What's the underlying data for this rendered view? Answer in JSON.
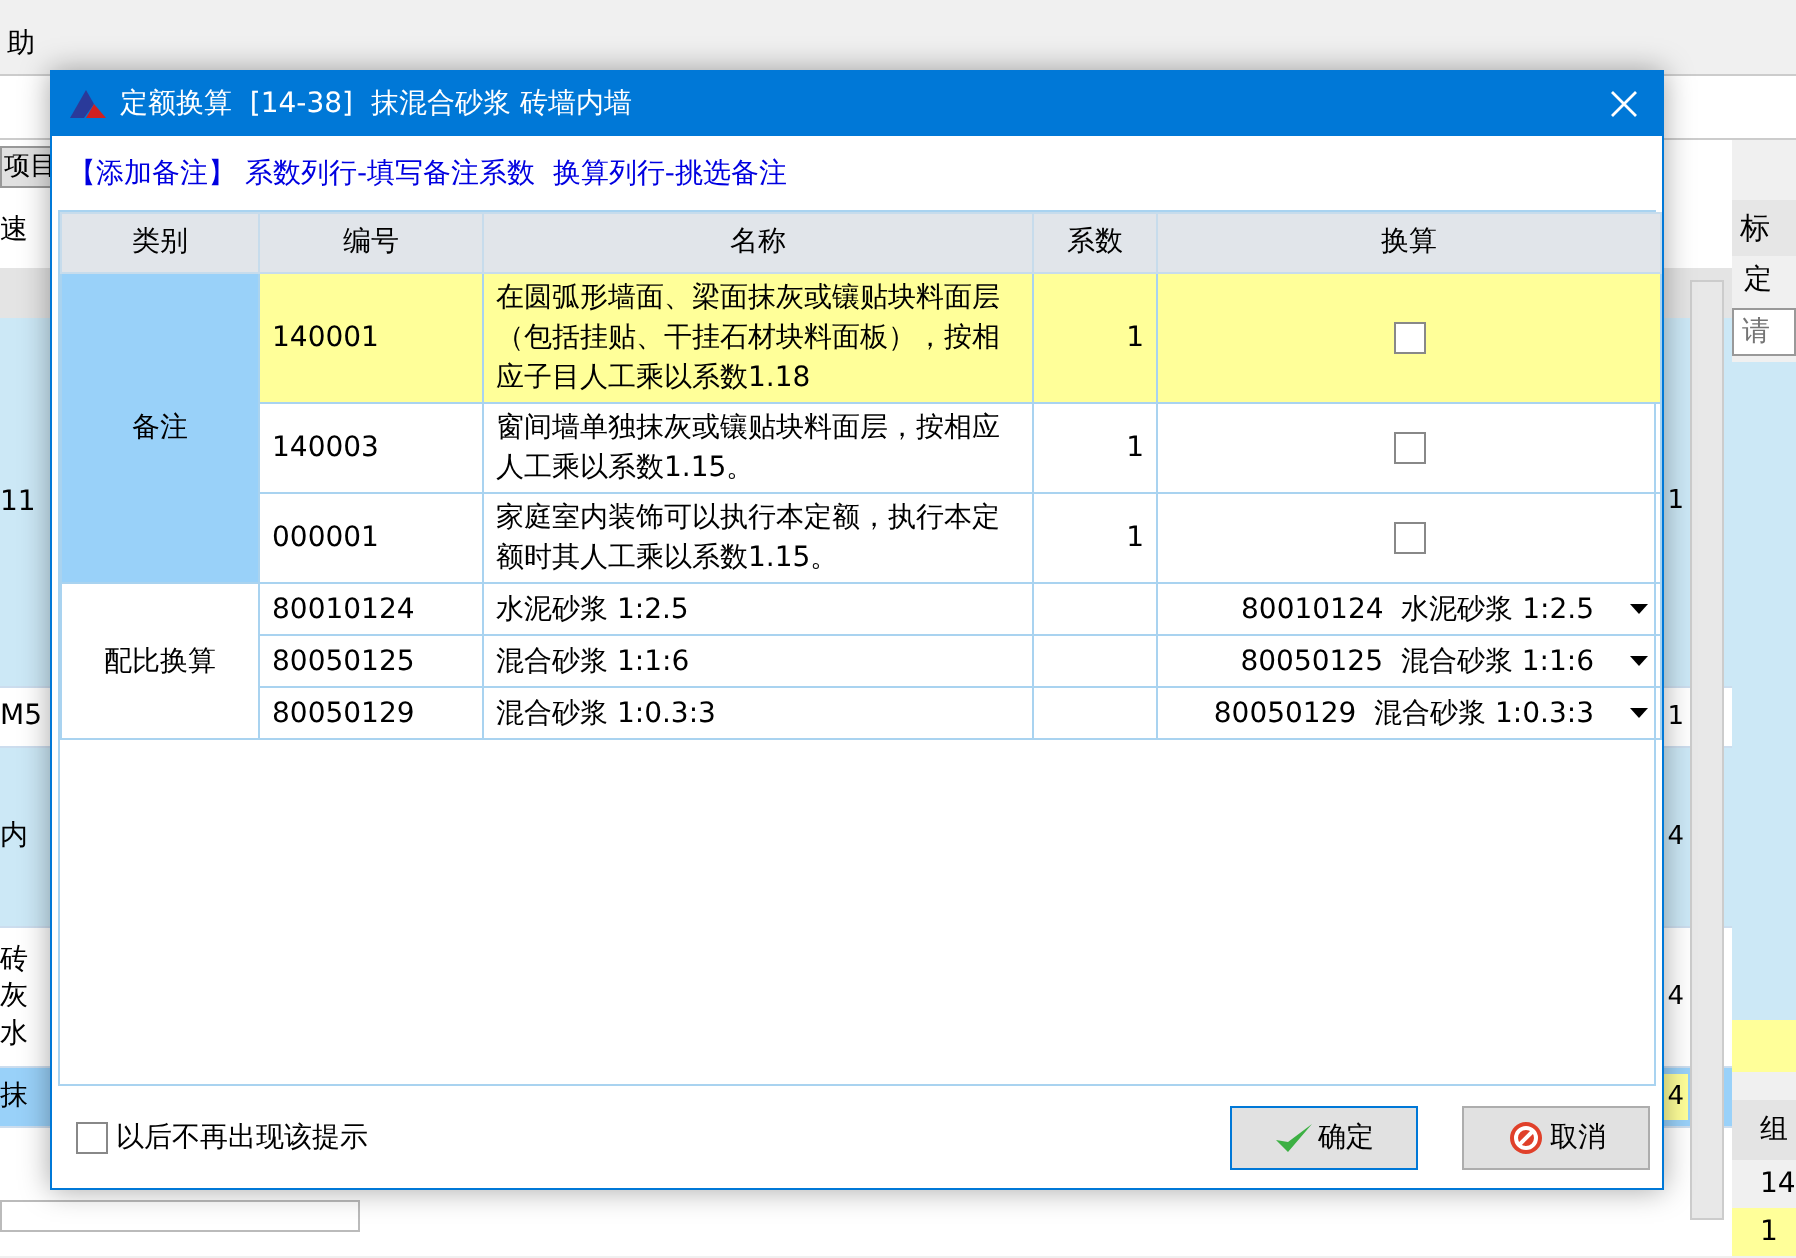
{
  "app": {
    "menu": [
      "助"
    ],
    "left_tab": "项目",
    "left_label": "速",
    "rows": [
      {
        "text": "11",
        "value": "1",
        "kind": "tall",
        "selected": false
      },
      {
        "text": "M5",
        "value": "1",
        "kind": "short",
        "selected": false
      },
      {
        "text": "内",
        "value": "4",
        "kind": "mid",
        "selected": false
      },
      {
        "lines": [
          "砖",
          "灰",
          "水"
        ],
        "value": "4",
        "kind": "white",
        "selected": false
      },
      {
        "text": "抹",
        "value": "4",
        "kind": "short",
        "selected": true
      }
    ],
    "right_tab": "标",
    "right_label": "定",
    "right_placeholder": "请",
    "right_header": "组",
    "right_cells": [
      "14",
      "1"
    ]
  },
  "dialog": {
    "title": "定额换算  [14-38]  抹混合砂浆 砖墙内墙",
    "hint": "【添加备注】 系数列行-填写备注系数  换算列行-挑选备注",
    "table": {
      "columns": [
        "类别",
        "编号",
        "名称",
        "系数",
        "换算"
      ],
      "groups": [
        {
          "category": "备注",
          "selected": true,
          "rows": [
            {
              "code": "140001",
              "name": "在圆弧形墙面、梁面抹灰或镶贴块料面层（包括挂贴、干挂石材块料面板），按相应子目人工乘以系数1.18",
              "factor": "1",
              "kind": "checkbox",
              "checked": false,
              "selected": true
            },
            {
              "code": "140003",
              "name": "窗间墙单独抹灰或镶贴块料面层，按相应人工乘以系数1.15。",
              "factor": "1",
              "kind": "checkbox",
              "checked": false,
              "selected": false
            },
            {
              "code": "000001",
              "name": "家庭室内装饰可以执行本定额，执行本定额时其人工乘以系数1.15。",
              "factor": "1",
              "kind": "checkbox",
              "checked": false,
              "selected": false
            }
          ]
        },
        {
          "category": "配比换算",
          "selected": false,
          "rows": [
            {
              "code": "80010124",
              "name": "水泥砂浆 1:2.5",
              "kind": "dropdown",
              "value": "80010124  水泥砂浆 1:2.5",
              "selected": false
            },
            {
              "code": "80050125",
              "name": "混合砂浆 1:1:6",
              "kind": "dropdown",
              "value": "80050125  混合砂浆 1:1:6",
              "selected": false
            },
            {
              "code": "80050129",
              "name": "混合砂浆 1:0.3:3",
              "kind": "dropdown",
              "value": "80050129  混合砂浆 1:0.3:3",
              "selected": false
            }
          ]
        }
      ]
    },
    "dont_show_again": {
      "label": "以后不再出现该提示",
      "checked": false
    },
    "buttons": [
      {
        "label": "确定",
        "kind": "ok"
      },
      {
        "label": "取消",
        "kind": "cancel"
      }
    ]
  }
}
